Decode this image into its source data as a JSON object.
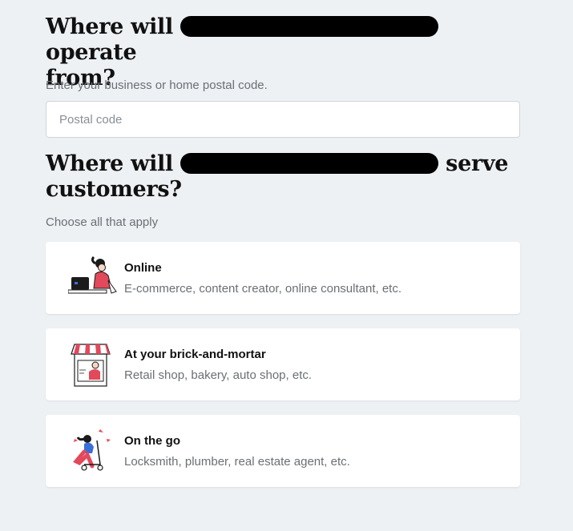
{
  "operate": {
    "heading_start": "Where will",
    "heading_end": "operate",
    "heading_line2": "from?",
    "helper": "Enter your business or home postal code.",
    "postal_placeholder": "Postal code"
  },
  "serve": {
    "heading_start": "Where will",
    "heading_end": "serve",
    "heading_line2": "customers?",
    "helper": "Choose all that apply",
    "options": [
      {
        "title": "Online",
        "description": "E-commerce, content creator, online consultant, etc.",
        "icon": "laptop-person-icon"
      },
      {
        "title": "At your brick-and-mortar",
        "description": "Retail shop, bakery, auto shop, etc.",
        "icon": "storefront-icon"
      },
      {
        "title": "On the go",
        "description": "Locksmith, plumber, real estate agent, etc.",
        "icon": "scooter-person-icon"
      }
    ]
  },
  "colors": {
    "background": "#eef1f4",
    "accent_red": "#e2495b",
    "accent_blue": "#3b6fd8"
  }
}
